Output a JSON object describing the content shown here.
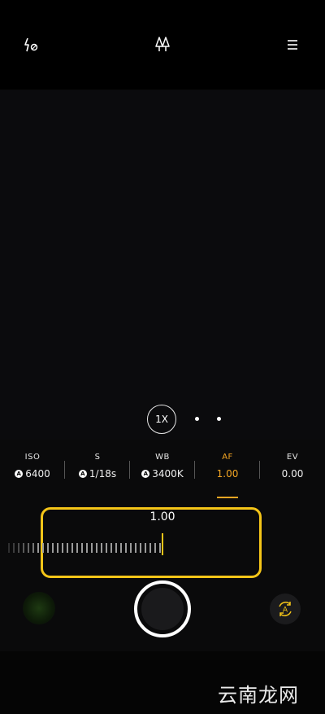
{
  "topbar": {
    "flash_icon": "flash-auto-icon",
    "macro_icon": "macro-tree-icon",
    "menu_icon": "menu-icon"
  },
  "zoom": {
    "label": "1X"
  },
  "params": [
    {
      "key": "iso",
      "label": "ISO",
      "value": "6400",
      "auto": true
    },
    {
      "key": "s",
      "label": "S",
      "value": "1/18s",
      "auto": true
    },
    {
      "key": "wb",
      "label": "WB",
      "value": "3400K",
      "auto": true
    },
    {
      "key": "af",
      "label": "AF",
      "value": "1.00",
      "auto": false
    },
    {
      "key": "ev",
      "label": "EV",
      "value": "0.00",
      "auto": false
    }
  ],
  "auto_badge": "A",
  "slider": {
    "value": "1.00"
  },
  "auto_mode_icon": "auto-rotate-icon",
  "auto_mode_label": "A",
  "watermark": "云南龙网",
  "colors": {
    "accent": "#f5a623",
    "slider_border": "#f5c518"
  }
}
